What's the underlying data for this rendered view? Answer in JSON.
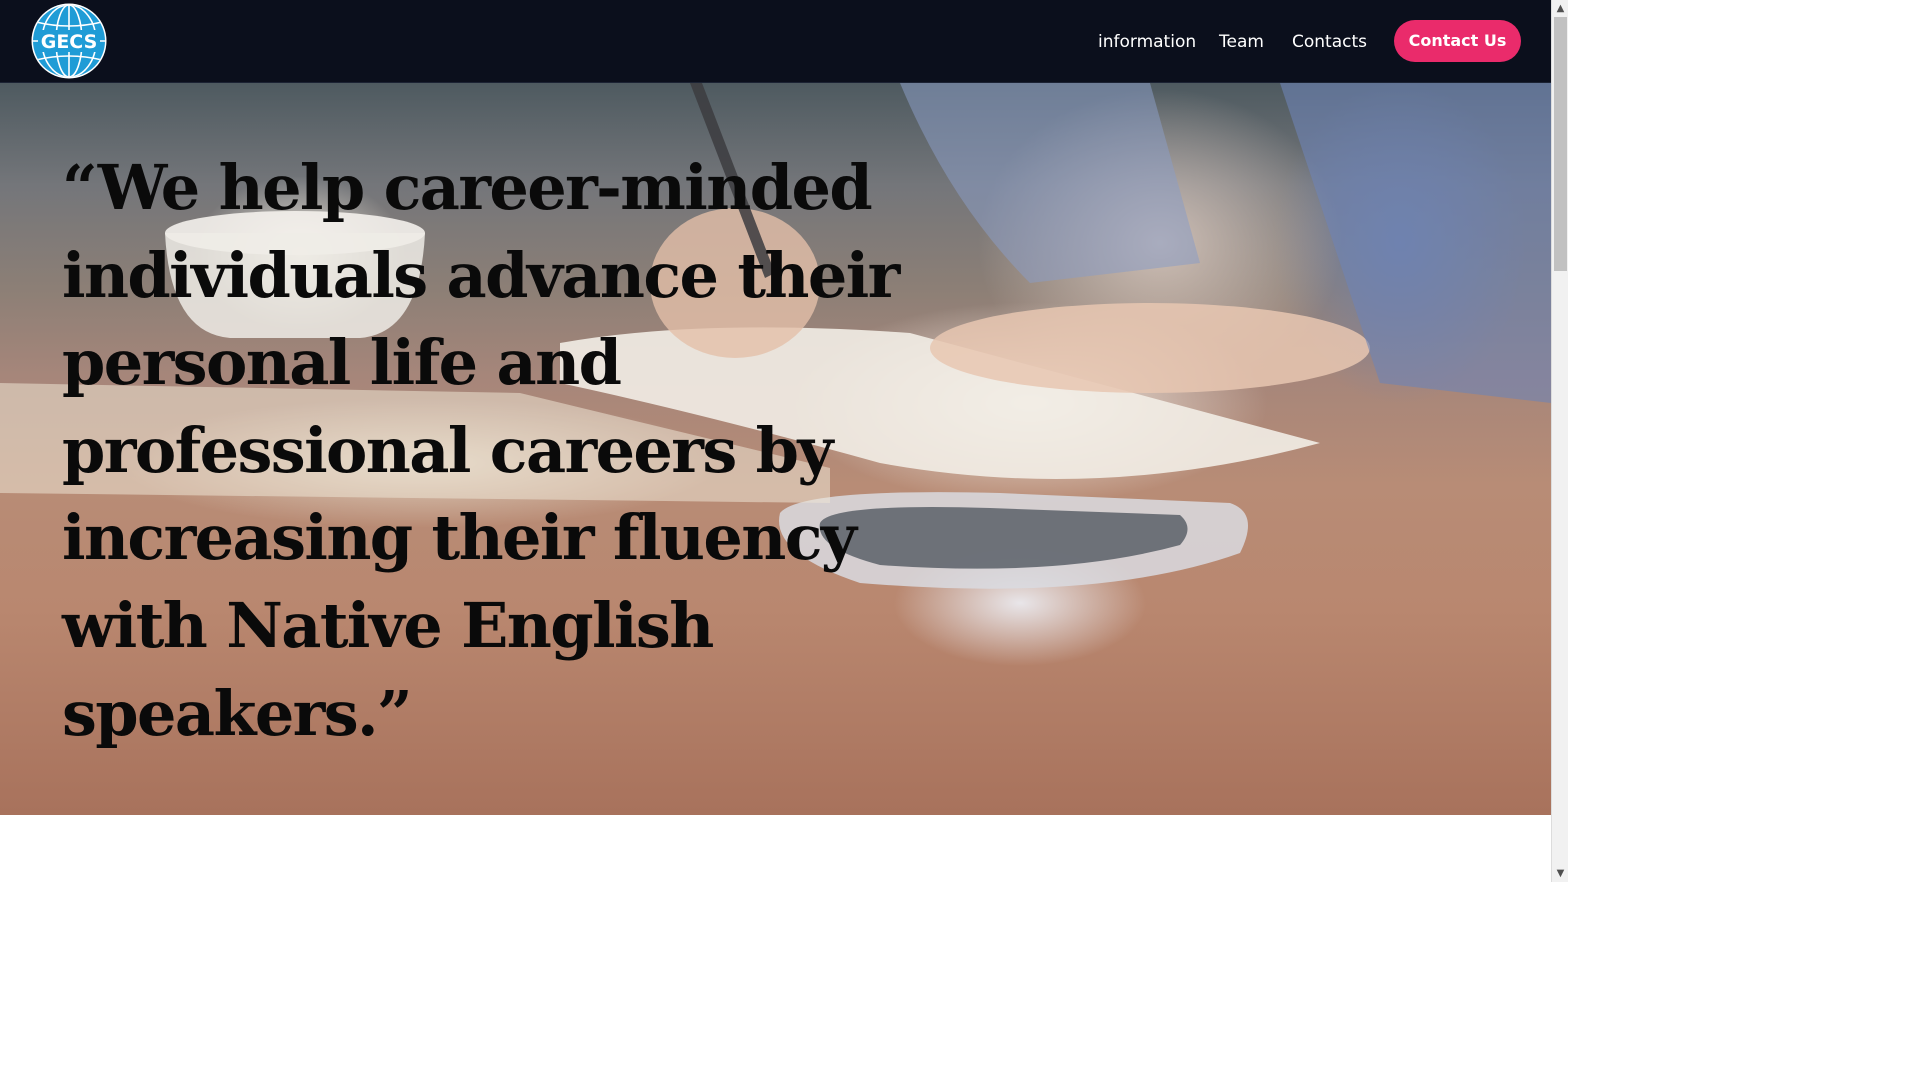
{
  "header": {
    "logo_text": "GECS",
    "nav": [
      {
        "label": "information"
      },
      {
        "label": "Team"
      },
      {
        "label": "Contacts"
      }
    ],
    "cta_label": "Contact Us"
  },
  "hero": {
    "quote": "“We help career-minded individuals advance their personal life and professional careers by increasing their fluency with Native English speakers.”"
  },
  "scrollbar": {
    "up_icon": "chevron-up-icon",
    "down_icon": "chevron-down-icon"
  },
  "colors": {
    "nav_background": "#0b0f1c",
    "accent": "#ea2b6b",
    "logo_blue": "#1f9cd6",
    "quote_text": "#0a0a0a"
  }
}
